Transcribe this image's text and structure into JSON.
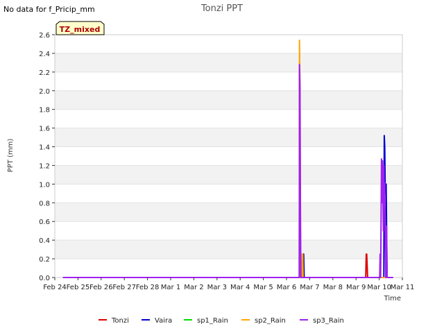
{
  "no_data_note": "No data for f_Pricip_mm",
  "chart_data": {
    "type": "line",
    "title": "Tonzi PPT",
    "xlabel": "Time",
    "ylabel": "PPT (mm)",
    "site_badge": "TZ_mixed",
    "xlim": [
      0,
      15
    ],
    "ylim": [
      0,
      2.6
    ],
    "x_tick_labels": [
      "Feb 24",
      "Feb 25",
      "Feb 26",
      "Feb 27",
      "Feb 28",
      "Mar 1",
      "Mar 2",
      "Mar 3",
      "Mar 4",
      "Mar 5",
      "Mar 6",
      "Mar 7",
      "Mar 8",
      "Mar 9",
      "Mar 10",
      "Mar 11"
    ],
    "y_ticks": [
      0.0,
      0.2,
      0.4,
      0.6,
      0.8,
      1.0,
      1.2,
      1.4,
      1.6,
      1.8,
      2.0,
      2.2,
      2.4,
      2.6
    ],
    "y_tick_labels": [
      "0.0",
      "0.2",
      "0.4",
      "0.6",
      "0.8",
      "1.0",
      "1.2",
      "1.4",
      "1.6",
      "1.8",
      "2.0",
      "2.2",
      "2.4",
      "2.6"
    ],
    "grid": "horizontal bands",
    "legend_position": "bottom",
    "series": [
      {
        "name": "Tonzi",
        "color": "#dd0000",
        "x": [
          0.35,
          13.42,
          13.44,
          13.46,
          13.5,
          14.6
        ],
        "y": [
          0,
          0,
          0.25,
          0.25,
          0,
          0
        ]
      },
      {
        "name": "Vaira",
        "color": "#0000cc",
        "x": [
          0.35,
          10.55,
          10.56,
          10.58,
          10.6,
          10.62,
          10.64,
          10.66,
          10.68,
          10.7,
          10.72,
          10.74,
          10.76,
          10.78,
          14.2,
          14.22,
          14.24,
          14.26,
          14.3,
          14.32,
          14.34,
          14.6
        ],
        "y": [
          0,
          0,
          2.28,
          1.6,
          0.3,
          0,
          0,
          0,
          0,
          0,
          0.25,
          0.25,
          0,
          0,
          0,
          1.52,
          1.4,
          0.9,
          1.0,
          0.5,
          0,
          0
        ]
      },
      {
        "name": "sp1_Rain",
        "color": "#00dd00",
        "x": [
          0.35,
          14.6
        ],
        "y": [
          0,
          0
        ]
      },
      {
        "name": "sp2_Rain",
        "color": "#ffa500",
        "x": [
          0.35,
          10.55,
          10.56,
          10.58,
          10.6,
          10.62,
          10.64,
          10.66,
          10.68,
          10.7,
          10.72,
          14.6
        ],
        "y": [
          0,
          0,
          2.54,
          2.0,
          0.4,
          0,
          0,
          0,
          0.25,
          0.25,
          0,
          0
        ]
      },
      {
        "name": "sp3_Rain",
        "color": "#a020f0",
        "x": [
          0.35,
          10.55,
          10.56,
          10.58,
          10.6,
          10.62,
          10.65,
          14.02,
          14.04,
          14.06,
          14.08,
          14.1,
          14.12,
          14.14,
          14.16,
          14.18,
          14.2,
          14.22,
          14.24,
          14.26,
          14.28,
          14.3,
          14.32,
          14.34,
          14.6
        ],
        "y": [
          0,
          0,
          2.28,
          2.05,
          0.8,
          0,
          0,
          0,
          0.25,
          0,
          0.6,
          1.27,
          0.8,
          1.25,
          0.95,
          0.5,
          1.2,
          0.8,
          1.01,
          0.5,
          0,
          0.35,
          0.55,
          0,
          0
        ]
      }
    ]
  }
}
